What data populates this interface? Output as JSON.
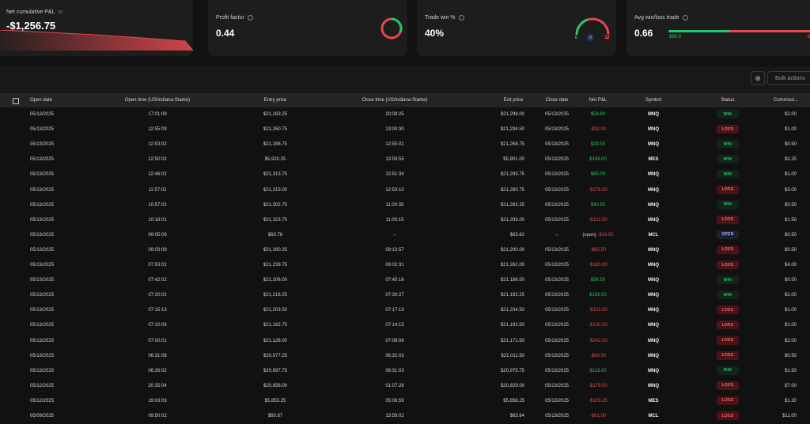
{
  "cards": {
    "net_pnl": {
      "title": "Net cumulative P&L",
      "sup": "20",
      "value": "-$1,256.75"
    },
    "profit_factor": {
      "title": "Profit factor",
      "value": "0.44",
      "ring_fraction": 0.44
    },
    "trade_win": {
      "title": "Trade win %",
      "value": "40%",
      "wins": "6",
      "breakeven": "0",
      "losses": "12",
      "win_fraction": 0.4
    },
    "avg_win_loss": {
      "title": "Avg win/loss trade",
      "value": "0.66",
      "avg_win": "$90.9",
      "avg_loss": "-$"
    }
  },
  "toolbar": {
    "settings_icon": "⊕",
    "bulk_actions_label": "Bulk actions"
  },
  "table": {
    "headers": {
      "open_date": "Open date",
      "open_time": "Open time (US/Indiana-Starke)",
      "entry_price": "Entry price",
      "close_time": "Close time (US/Indiana-Starke)",
      "exit_price": "Exit price",
      "close_date": "Close date",
      "net_pnl": "Net P&L",
      "symbol": "Symbol",
      "status": "Status",
      "commission": "Commissi..."
    },
    "rows": [
      {
        "open_date": "05/13/2025",
        "open_time": "17:01:09",
        "entry_price": "$21,283.25",
        "close_time": "20:08:25",
        "exit_price": "$21,298.00",
        "close_date": "05/13/2025",
        "net_pnl": "$58.80",
        "pnl_kind": "pos",
        "symbol": "MNQ",
        "status": "WIN",
        "commission": "$2.00"
      },
      {
        "open_date": "05/13/2025",
        "open_time": "12:55:09",
        "entry_price": "$21,260.75",
        "close_time": "13:00:30",
        "exit_price": "$21,234.50",
        "close_date": "05/13/2025",
        "net_pnl": "-$32.00",
        "pnl_kind": "neg",
        "symbol": "MNQ",
        "status": "LOSS",
        "commission": "$1.00"
      },
      {
        "open_date": "05/13/2025",
        "open_time": "12:53:02",
        "entry_price": "$21,288.75",
        "close_time": "12:55:01",
        "exit_price": "$21,268.75",
        "close_date": "05/13/2025",
        "net_pnl": "$39.50",
        "pnl_kind": "pos",
        "symbol": "MNQ",
        "status": "WIN",
        "commission": "$0.50"
      },
      {
        "open_date": "05/13/2025",
        "open_time": "12:50:02",
        "entry_price": "$5,920.25",
        "close_time": "13:59:55",
        "exit_price": "$5,901.00",
        "close_date": "05/13/2025",
        "net_pnl": "$194.00",
        "pnl_kind": "pos",
        "symbol": "MES",
        "status": "WIN",
        "commission": "$2.25"
      },
      {
        "open_date": "05/13/2025",
        "open_time": "12:46:02",
        "entry_price": "$21,313.75",
        "close_time": "12:51:34",
        "exit_price": "$21,293.75",
        "close_date": "05/13/2025",
        "net_pnl": "$80.00",
        "pnl_kind": "pos",
        "symbol": "MNQ",
        "status": "WIN",
        "commission": "$1.00"
      },
      {
        "open_date": "05/13/2025",
        "open_time": "11:57:02",
        "entry_price": "$21,315.00",
        "close_time": "12:53:10",
        "exit_price": "$21,280.75",
        "close_date": "05/13/2025",
        "net_pnl": "-$276.50",
        "pnl_kind": "neg",
        "symbol": "MNQ",
        "status": "LOSS",
        "commission": "$3.00"
      },
      {
        "open_date": "05/13/2025",
        "open_time": "10:57:02",
        "entry_price": "$21,302.75",
        "close_time": "11:00:35",
        "exit_price": "$21,282.25",
        "close_date": "05/13/2025",
        "net_pnl": "$40.50",
        "pnl_kind": "pos",
        "symbol": "MNQ",
        "status": "WIN",
        "commission": "$0.50"
      },
      {
        "open_date": "05/13/2025",
        "open_time": "10:18:01",
        "entry_price": "$21,323.75",
        "close_time": "11:00:15",
        "exit_price": "$21,293.00",
        "close_date": "05/13/2025",
        "net_pnl": "-$122.50",
        "pnl_kind": "neg",
        "symbol": "MNQ",
        "status": "LOSS",
        "commission": "$1.50"
      },
      {
        "open_date": "05/13/2025",
        "open_time": "09:05:09",
        "entry_price": "$63.78",
        "close_time": "--",
        "exit_price": "$63.62",
        "close_date": "--",
        "net_pnl_prefix": "(open)",
        "net_pnl": "-$16.50",
        "pnl_kind": "neg",
        "symbol": "MCL",
        "status": "OPEN",
        "commission": "$0.50"
      },
      {
        "open_date": "05/13/2025",
        "open_time": "09:03:09",
        "entry_price": "$21,260.25",
        "close_time": "09:13:57",
        "exit_price": "$21,290.00",
        "close_date": "05/13/2025",
        "net_pnl": "-$60.50",
        "pnl_kind": "neg",
        "symbol": "MNQ",
        "status": "LOSS",
        "commission": "$0.50"
      },
      {
        "open_date": "05/13/2025",
        "open_time": "07:53:02",
        "entry_price": "$21,239.75",
        "close_time": "09:02:31",
        "exit_price": "$21,262.00",
        "close_date": "05/13/2025",
        "net_pnl": "-$183.00",
        "pnl_kind": "neg",
        "symbol": "MNQ",
        "status": "LOSS",
        "commission": "$4.00"
      },
      {
        "open_date": "05/13/2025",
        "open_time": "07:42:02",
        "entry_price": "$21,206.00",
        "close_time": "07:45:16",
        "exit_price": "$21,186.50",
        "close_date": "05/13/2025",
        "net_pnl": "$38.50",
        "pnl_kind": "pos",
        "symbol": "MNQ",
        "status": "WIN",
        "commission": "$0.50"
      },
      {
        "open_date": "05/13/2025",
        "open_time": "07:20:02",
        "entry_price": "$21,216.25",
        "close_time": "07:30:27",
        "exit_price": "$21,192.25",
        "close_date": "05/13/2025",
        "net_pnl": "$158.50",
        "pnl_kind": "pos",
        "symbol": "MNQ",
        "status": "WIN",
        "commission": "$2.00"
      },
      {
        "open_date": "05/13/2025",
        "open_time": "07:15:13",
        "entry_price": "$21,203.50",
        "close_time": "07:17:13",
        "exit_price": "$21,234.50",
        "close_date": "05/13/2025",
        "net_pnl": "-$122.00",
        "pnl_kind": "neg",
        "symbol": "MNQ",
        "status": "LOSS",
        "commission": "$1.00"
      },
      {
        "open_date": "05/13/2025",
        "open_time": "07:10:06",
        "entry_price": "$21,162.75",
        "close_time": "07:14:15",
        "exit_price": "$21,192.50",
        "close_date": "05/13/2025",
        "net_pnl": "-$120.00",
        "pnl_kind": "neg",
        "symbol": "MNQ",
        "status": "LOSS",
        "commission": "$1.00"
      },
      {
        "open_date": "05/13/2025",
        "open_time": "07:00:01",
        "entry_price": "$21,126.00",
        "close_time": "07:08:06",
        "exit_price": "$21,171.50",
        "close_date": "05/13/2025",
        "net_pnl": "-$242.00",
        "pnl_kind": "neg",
        "symbol": "MNQ",
        "status": "LOSS",
        "commission": "$2.00"
      },
      {
        "open_date": "05/13/2025",
        "open_time": "06:31:08",
        "entry_price": "$20,977.25",
        "close_time": "06:32:03",
        "exit_price": "$21,011.50",
        "close_date": "05/13/2025",
        "net_pnl": "-$69.00",
        "pnl_kind": "neg",
        "symbol": "MNQ",
        "status": "LOSS",
        "commission": "$0.50"
      },
      {
        "open_date": "05/13/2025",
        "open_time": "06:26:02",
        "entry_price": "$20,997.75",
        "close_time": "06:31:03",
        "exit_price": "$20,975.75",
        "close_date": "05/13/2025",
        "net_pnl": "$118.00",
        "pnl_kind": "pos",
        "symbol": "MNQ",
        "status": "WIN",
        "commission": "$1.50"
      },
      {
        "open_date": "05/12/2025",
        "open_time": "20:35:04",
        "entry_price": "$20,856.00",
        "close_time": "01:07:26",
        "exit_price": "$20,829.00",
        "close_date": "05/13/2025",
        "net_pnl": "-$179.00",
        "pnl_kind": "neg",
        "symbol": "MNQ",
        "status": "LOSS",
        "commission": "$7.00"
      },
      {
        "open_date": "05/12/2025",
        "open_time": "19:03:03",
        "entry_price": "$5,853.25",
        "close_time": "05:06:59",
        "exit_price": "$5,858.25",
        "close_date": "05/13/2025",
        "net_pnl": "-$103.25",
        "pnl_kind": "neg",
        "symbol": "MES",
        "status": "LOSS",
        "commission": "$1.30"
      },
      {
        "open_date": "05/09/2025",
        "open_time": "09:50:02",
        "entry_price": "$60.87",
        "close_time": "13:59:02",
        "exit_price": "$63.64",
        "close_date": "05/13/2025",
        "net_pnl": "-$61.00",
        "pnl_kind": "neg",
        "symbol": "MCL",
        "status": "LOSS",
        "commission": "$11.00"
      }
    ]
  },
  "colors": {
    "win": "#29c467",
    "loss": "#e5484d",
    "background": "#111111",
    "card": "#1d1d1d"
  }
}
